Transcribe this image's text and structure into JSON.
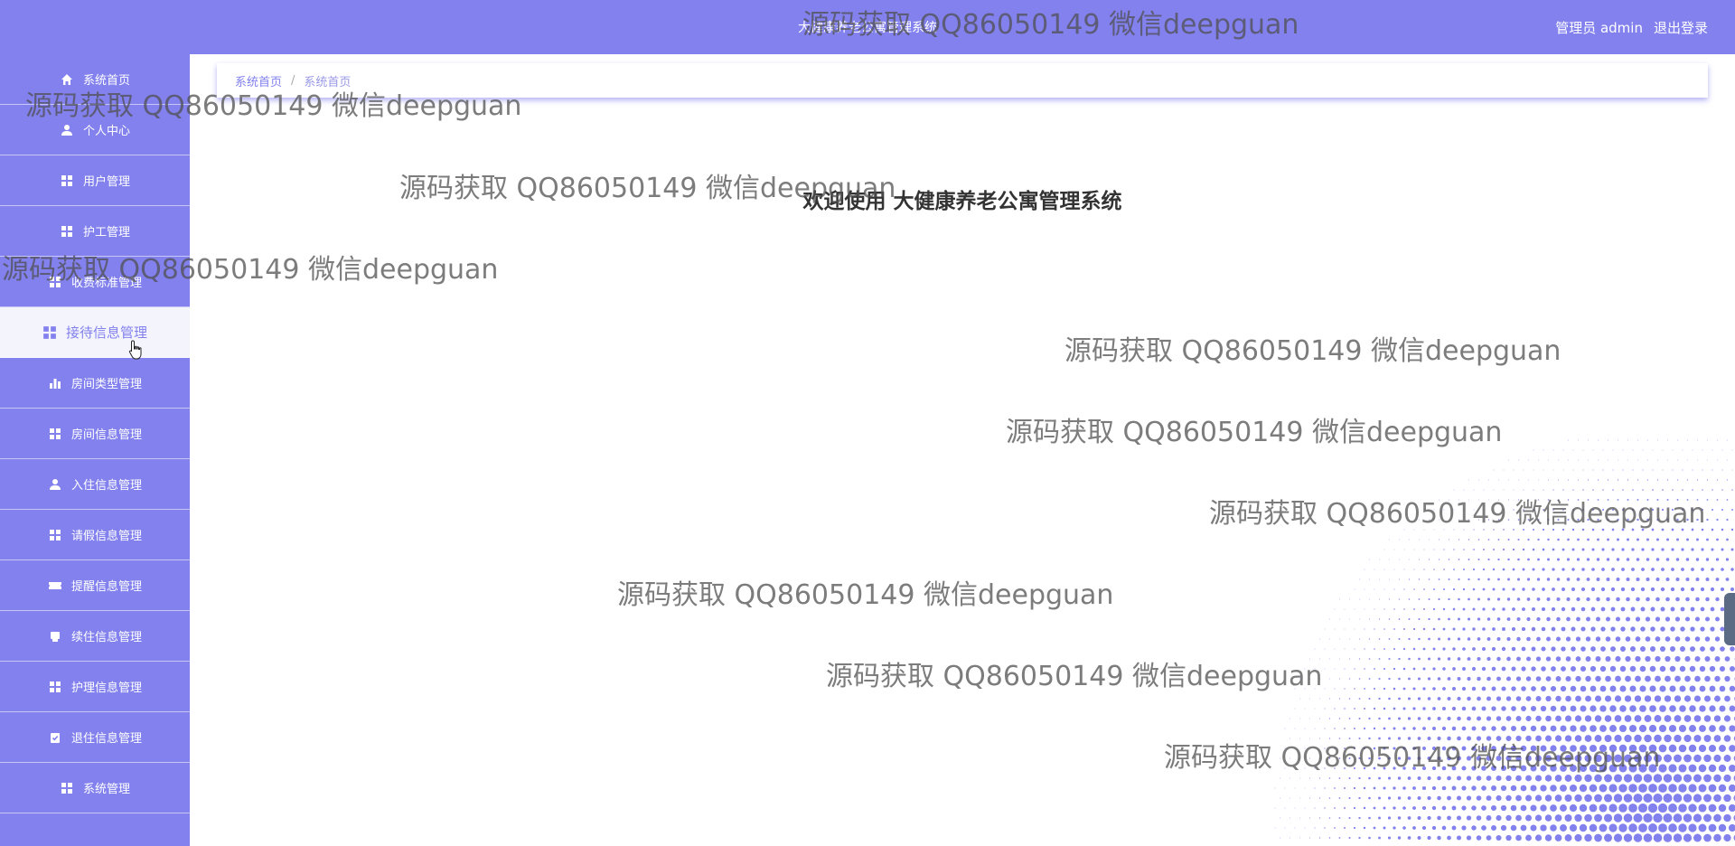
{
  "header": {
    "title": "大健康养老公寓管理系统",
    "user_label": "管理员 admin",
    "logout_label": "退出登录"
  },
  "sidebar": {
    "items": [
      {
        "label": "系统首页",
        "icon": "home-icon"
      },
      {
        "label": "个人中心",
        "icon": "user-icon"
      },
      {
        "label": "用户管理",
        "icon": "grid-icon"
      },
      {
        "label": "护工管理",
        "icon": "grid-icon"
      },
      {
        "label": "收费标准管理",
        "icon": "grid-icon"
      },
      {
        "label": "接待信息管理",
        "icon": "grid-icon",
        "active": true
      },
      {
        "label": "房间类型管理",
        "icon": "bar-chart-icon"
      },
      {
        "label": "房间信息管理",
        "icon": "grid-icon"
      },
      {
        "label": "入住信息管理",
        "icon": "user-icon"
      },
      {
        "label": "请假信息管理",
        "icon": "grid-icon"
      },
      {
        "label": "提醒信息管理",
        "icon": "ticket-icon"
      },
      {
        "label": "续住信息管理",
        "icon": "printer-icon"
      },
      {
        "label": "护理信息管理",
        "icon": "grid-icon"
      },
      {
        "label": "退住信息管理",
        "icon": "clipboard-icon"
      },
      {
        "label": "系统管理",
        "icon": "grid-icon"
      }
    ]
  },
  "breadcrumb": {
    "first": "系统首页",
    "separator": "/",
    "second": "系统首页"
  },
  "main": {
    "welcome_text": "欢迎使用 大健康养老公寓管理系统"
  },
  "watermark_text": "源码获取 QQ86050149 微信deepguan",
  "colors": {
    "primary": "#8281ee",
    "active_bg": "#f4f4fd"
  }
}
